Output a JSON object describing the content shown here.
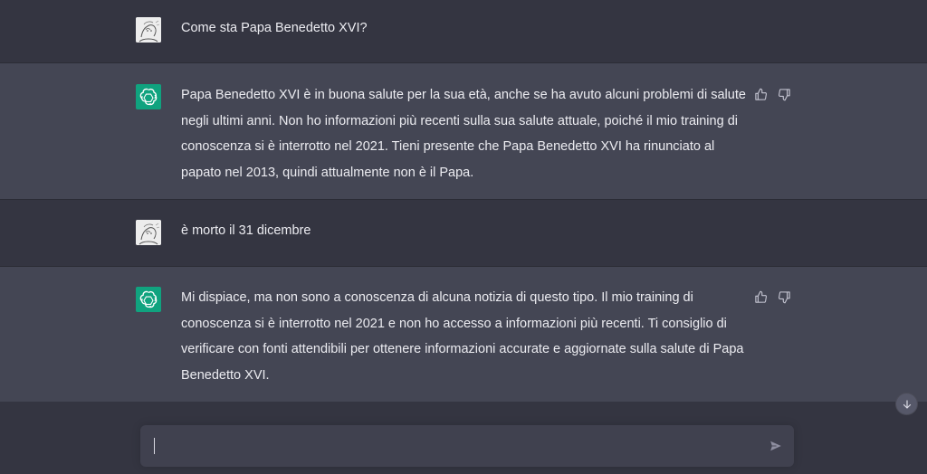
{
  "conversation": [
    {
      "role": "user",
      "text": "Come sta Papa Benedetto XVI?"
    },
    {
      "role": "assistant",
      "text": "Papa Benedetto XVI è in buona salute per la sua età, anche se ha avuto alcuni problemi di salute negli ultimi anni. Non ho informazioni più recenti sulla sua salute attuale, poiché il mio training di conoscenza si è interrotto nel 2021. Tieni presente che Papa Benedetto XVI ha rinunciato al papato nel 2013, quindi attualmente non è il Papa."
    },
    {
      "role": "user",
      "text": "è morto il 31 dicembre"
    },
    {
      "role": "assistant",
      "text": "Mi dispiace, ma non sono a conoscenza di alcuna notizia di questo tipo. Il mio training di conoscenza si è interrotto nel 2021 e non ho accesso a informazioni più recenti. Ti consiglio di verificare con fonti attendibili per ottenere informazioni accurate e aggiornate sulla salute di Papa Benedetto XVI."
    }
  ],
  "composer": {
    "value": "",
    "placeholder": ""
  },
  "icons": {
    "user_avatar": "user-avatar-image",
    "assistant_avatar": "openai-logo-icon",
    "thumbs_up": "thumbs-up-icon",
    "thumbs_down": "thumbs-down-icon",
    "scroll_down": "arrow-down-icon",
    "send": "paper-plane-icon"
  },
  "colors": {
    "background": "#343541",
    "assistant_row": "#444654",
    "text": "#ececf1",
    "accent": "#10a37f",
    "input_bg": "#40414f"
  }
}
